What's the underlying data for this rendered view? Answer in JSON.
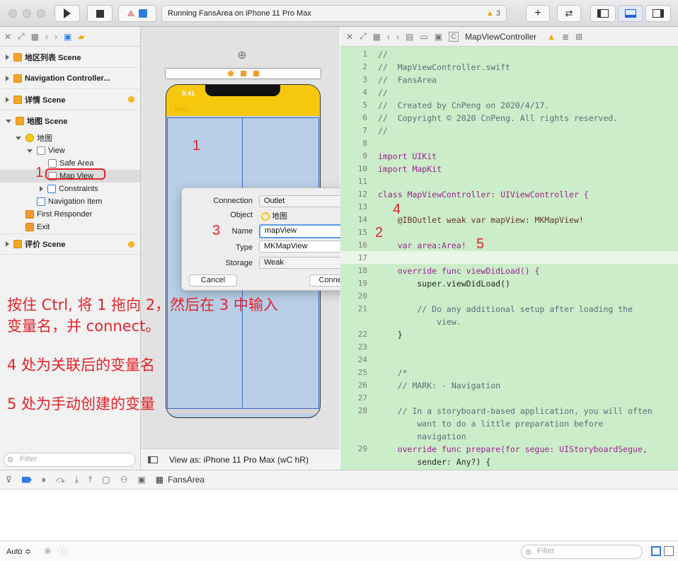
{
  "toolbar": {
    "status": "Running FansArea on iPhone 11 Pro Max",
    "warnings": "3"
  },
  "navigator": {
    "scenes": [
      {
        "label": "地区列表 Scene"
      },
      {
        "label": "Navigation Controller..."
      },
      {
        "label": "详情 Scene"
      },
      {
        "label": "地图 Scene"
      },
      {
        "label": "评价 Scene"
      }
    ],
    "map_items": {
      "map": "地图",
      "view": "View",
      "safe_area": "Safe Area",
      "map_view": "Map View",
      "constraints": "Constraints",
      "nav_item": "Navigation Item",
      "first_responder": "First Responder",
      "exit": "Exit"
    },
    "filter_placeholder": "Filter"
  },
  "canvas": {
    "time": "9:41",
    "back": "Back",
    "view_as": "View as: iPhone 11 Pro Max (wC hR)"
  },
  "popover": {
    "connection_label": "Connection",
    "connection_value": "Outlet",
    "object_label": "Object",
    "object_value": "地图",
    "name_label": "Name",
    "name_value": "mapView",
    "type_label": "Type",
    "type_value": "MKMapView",
    "storage_label": "Storage",
    "storage_value": "Weak",
    "cancel": "Cancel",
    "connect": "Connect"
  },
  "editor": {
    "breadcrumb": "MapViewController",
    "lines": [
      {
        "n": "1",
        "t": "//"
      },
      {
        "n": "2",
        "t": "//  MapViewController.swift"
      },
      {
        "n": "3",
        "t": "//  FansArea"
      },
      {
        "n": "4",
        "t": "//"
      },
      {
        "n": "5",
        "t": "//  Created by CnPeng on 2020/4/17."
      },
      {
        "n": "6",
        "t": "//  Copyright © 2020 CnPeng. All rights reserved."
      },
      {
        "n": "7",
        "t": "//"
      },
      {
        "n": "8",
        "t": ""
      },
      {
        "n": "9",
        "t": "import UIKit"
      },
      {
        "n": "10",
        "t": "import MapKit"
      },
      {
        "n": "11",
        "t": ""
      },
      {
        "n": "12",
        "t": "class MapViewController: UIViewController {"
      },
      {
        "n": "13",
        "t": ""
      },
      {
        "n": "14",
        "t": "    @IBOutlet weak var mapView: MKMapView!"
      },
      {
        "n": "15",
        "t": ""
      },
      {
        "n": "16",
        "t": "    var area:Area!"
      },
      {
        "n": "17",
        "t": ""
      },
      {
        "n": "18",
        "t": "    override func viewDidLoad() {"
      },
      {
        "n": "19",
        "t": "        super.viewDidLoad()"
      },
      {
        "n": "20",
        "t": ""
      },
      {
        "n": "21",
        "t": "        // Do any additional setup after loading the"
      },
      {
        "n": "",
        "t": "            view."
      },
      {
        "n": "22",
        "t": "    }"
      },
      {
        "n": "23",
        "t": ""
      },
      {
        "n": "24",
        "t": ""
      },
      {
        "n": "25",
        "t": "    /*"
      },
      {
        "n": "26",
        "t": "    // MARK: - Navigation"
      },
      {
        "n": "27",
        "t": ""
      },
      {
        "n": "28",
        "t": "    // In a storyboard-based application, you will often"
      },
      {
        "n": "",
        "t": "        want to do a little preparation before"
      },
      {
        "n": "",
        "t": "        navigation"
      },
      {
        "n": "29",
        "t": "    override func prepare(for segue: UIStoryboardSegue,"
      },
      {
        "n": "",
        "t": "        sender: Any?) {"
      }
    ]
  },
  "debug": {
    "scheme": "FansArea",
    "auto": "Auto ≎",
    "filter_placeholder": "Filter"
  },
  "annotations": {
    "n1a": "1",
    "n1b": "1",
    "n2": "2",
    "n3": "3",
    "n4": "4",
    "n5": "5",
    "line1": "按住 Ctrl, 将 1 拖向 2，然后在 3 中输入",
    "line2": "变量名，并 connect。",
    "line3": "4 处为关联后的变量名",
    "line4": "5 处为手动创建的变量"
  },
  "colors": {
    "canvas_bg": "#e2e2e2",
    "editor_bg": "#ccedc9",
    "annotation": "#e2232a",
    "nav_bar": "#f6c80d"
  }
}
